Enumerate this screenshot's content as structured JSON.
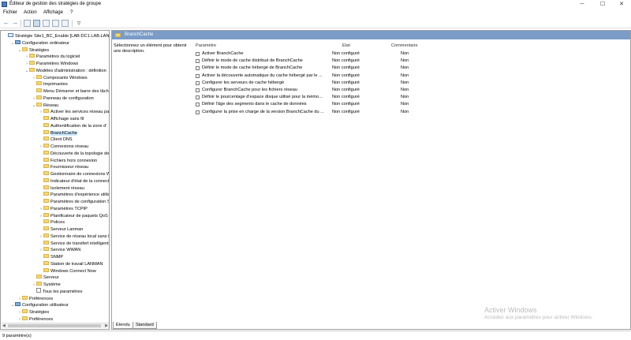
{
  "window": {
    "title": "Éditeur de gestion des stratégies de groupe",
    "controls": {
      "minimize": "─",
      "maximize": "☐",
      "close": "✕"
    }
  },
  "menu": {
    "items": [
      "Fichier",
      "Action",
      "Affichage",
      "?"
    ]
  },
  "tree": [
    {
      "label": "Stratégie Site1_BC_Enable [LAB-DC1.LAB.LAN]",
      "expander": "",
      "icon": "policy",
      "indent": 0,
      "selected": false
    },
    {
      "label": "Configuration ordinateur",
      "expander": "⌄",
      "icon": "computer",
      "indent": 1,
      "selected": false
    },
    {
      "label": "Stratégies",
      "expander": "⌄",
      "icon": "folder",
      "indent": 2,
      "selected": false
    },
    {
      "label": "Paramètres du logiciel",
      "expander": "›",
      "icon": "folder",
      "indent": 3,
      "selected": false
    },
    {
      "label": "Paramètres Windows",
      "expander": "›",
      "icon": "folder",
      "indent": 3,
      "selected": false
    },
    {
      "label": "Modèles d'administration : définition",
      "expander": "⌄",
      "icon": "folder",
      "indent": 3,
      "selected": false
    },
    {
      "label": "Composants Windows",
      "expander": "›",
      "icon": "folder",
      "indent": 4,
      "selected": false
    },
    {
      "label": "Imprimantes",
      "expander": "",
      "icon": "folder",
      "indent": 4,
      "selected": false
    },
    {
      "label": "Menu Démarrer et barre des tâche",
      "expander": "",
      "icon": "folder",
      "indent": 4,
      "selected": false
    },
    {
      "label": "Panneau de configuration",
      "expander": "›",
      "icon": "folder",
      "indent": 4,
      "selected": false
    },
    {
      "label": "Réseau",
      "expander": "⌄",
      "icon": "folder",
      "indent": 4,
      "selected": false
    },
    {
      "label": "Activer les services réseau pair",
      "expander": "›",
      "icon": "folder",
      "indent": 5,
      "selected": false
    },
    {
      "label": "Affichage sans fil",
      "expander": "",
      "icon": "folder",
      "indent": 5,
      "selected": false
    },
    {
      "label": "Authentification de la zone d'",
      "expander": "",
      "icon": "folder",
      "indent": 5,
      "selected": false
    },
    {
      "label": "BranchCache",
      "expander": "",
      "icon": "folder",
      "indent": 5,
      "selected": true
    },
    {
      "label": "Client DNS",
      "expander": "",
      "icon": "folder",
      "indent": 5,
      "selected": false
    },
    {
      "label": "Connexions réseau",
      "expander": "›",
      "icon": "folder",
      "indent": 5,
      "selected": false
    },
    {
      "label": "Découverte de la topologie de",
      "expander": "",
      "icon": "folder",
      "indent": 5,
      "selected": false
    },
    {
      "label": "Fichiers hors connexion",
      "expander": "",
      "icon": "folder",
      "indent": 5,
      "selected": false
    },
    {
      "label": "Fournisseur réseau",
      "expander": "",
      "icon": "folder",
      "indent": 5,
      "selected": false
    },
    {
      "label": "Gestionnaire de connexions W",
      "expander": "",
      "icon": "folder",
      "indent": 5,
      "selected": false
    },
    {
      "label": "Indicateur d'état de la connect",
      "expander": "",
      "icon": "folder",
      "indent": 5,
      "selected": false
    },
    {
      "label": "Isolement réseau",
      "expander": "",
      "icon": "folder",
      "indent": 5,
      "selected": false
    },
    {
      "label": "Paramètres d'expérience utilis",
      "expander": "",
      "icon": "folder",
      "indent": 5,
      "selected": false
    },
    {
      "label": "Paramètres de configuration S",
      "expander": "",
      "icon": "folder",
      "indent": 5,
      "selected": false
    },
    {
      "label": "Paramètres TCPIP",
      "expander": "›",
      "icon": "folder",
      "indent": 5,
      "selected": false
    },
    {
      "label": "Planificateur de paquets QoS",
      "expander": "›",
      "icon": "folder",
      "indent": 5,
      "selected": false
    },
    {
      "label": "Polices",
      "expander": "",
      "icon": "folder",
      "indent": 5,
      "selected": false
    },
    {
      "label": "Serveur Lanman",
      "expander": "",
      "icon": "folder",
      "indent": 5,
      "selected": false
    },
    {
      "label": "Service de réseau local sans fil",
      "expander": "›",
      "icon": "folder",
      "indent": 5,
      "selected": false
    },
    {
      "label": "Service de transfert intelligent",
      "expander": "",
      "icon": "folder",
      "indent": 5,
      "selected": false
    },
    {
      "label": "Service WWAN",
      "expander": "›",
      "icon": "folder",
      "indent": 5,
      "selected": false
    },
    {
      "label": "SNMP",
      "expander": "",
      "icon": "folder",
      "indent": 5,
      "selected": false
    },
    {
      "label": "Station de travail LANMAN",
      "expander": "",
      "icon": "folder",
      "indent": 5,
      "selected": false
    },
    {
      "label": "Windows Connect Now",
      "expander": "",
      "icon": "folder",
      "indent": 5,
      "selected": false
    },
    {
      "label": "Serveur",
      "expander": "",
      "icon": "folder",
      "indent": 4,
      "selected": false
    },
    {
      "label": "Système",
      "expander": "›",
      "icon": "folder",
      "indent": 4,
      "selected": false
    },
    {
      "label": "Tous les paramètres",
      "expander": "",
      "icon": "doc",
      "indent": 4,
      "selected": false
    },
    {
      "label": "Préférences",
      "expander": "›",
      "icon": "folder",
      "indent": 2,
      "selected": false
    },
    {
      "label": "Configuration utilisateur",
      "expander": "⌄",
      "icon": "computer",
      "indent": 1,
      "selected": false
    },
    {
      "label": "Stratégies",
      "expander": "›",
      "icon": "folder",
      "indent": 2,
      "selected": false
    },
    {
      "label": "Préférences",
      "expander": "›",
      "icon": "folder",
      "indent": 2,
      "selected": false
    }
  ],
  "details": {
    "header": "BranchCache",
    "description": "Sélectionnez un élément pour obtenir une description.",
    "columns": {
      "name": "Paramètre",
      "state": "État",
      "comment": "Commentaire"
    },
    "rows": [
      {
        "name": "Activer BranchCache",
        "state": "Non configuré",
        "comment": "Non"
      },
      {
        "name": "Définir le mode de cache distribué de BranchCache",
        "state": "Non configuré",
        "comment": "Non"
      },
      {
        "name": "Définir le mode de cache hébergé de BranchCache",
        "state": "Non configuré",
        "comment": "Non"
      },
      {
        "name": "Activer la découverte automatique du cache hébergé par le ...",
        "state": "Non configuré",
        "comment": "Non"
      },
      {
        "name": "Configurer les serveurs de cache hébergé",
        "state": "Non configuré",
        "comment": "Non"
      },
      {
        "name": "Configurer BranchCache pour les fichiers réseau",
        "state": "Non configuré",
        "comment": "Non"
      },
      {
        "name": "Définir le pourcentage d'espace disque utilisé pour la mémo...",
        "state": "Non configuré",
        "comment": "Non"
      },
      {
        "name": "Définir l'âge des segments dans le cache de données",
        "state": "Non configuré",
        "comment": "Non"
      },
      {
        "name": "Configurer la prise en charge de la version BranchCache du ...",
        "state": "Non configuré",
        "comment": "Non"
      }
    ]
  },
  "tabs": {
    "extended": "Étendu",
    "standard": "Standard"
  },
  "status": {
    "text": "9 paramètre(s)"
  },
  "watermark": {
    "line1": "Activer Windows",
    "line2": "Accédez aux paramètres pour activer Windows."
  }
}
